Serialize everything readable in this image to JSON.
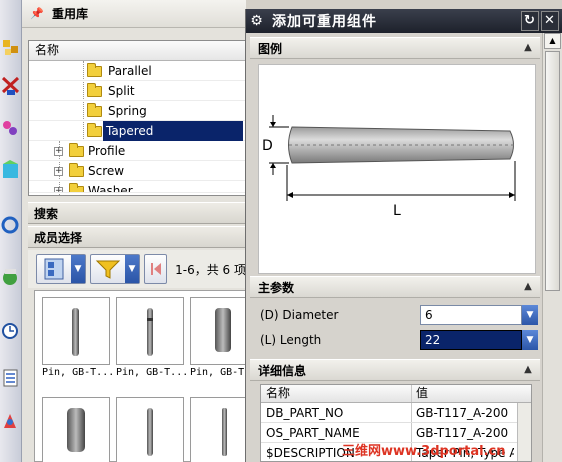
{
  "reuse_library": {
    "title": "重用库",
    "tree": {
      "column_header": "名称",
      "items": [
        {
          "label": "Parallel"
        },
        {
          "label": "Split"
        },
        {
          "label": "Spring"
        },
        {
          "label": "Tapered",
          "selected": true
        },
        {
          "label": "Profile"
        },
        {
          "label": "Screw"
        },
        {
          "label": "Washer"
        }
      ]
    },
    "search_label": "搜索",
    "member_select_label": "成员选择",
    "range_text": "1-6，共 6 项",
    "thumbnails": [
      {
        "caption": "Pin, GB-T..."
      },
      {
        "caption": "Pin, GB-T..."
      },
      {
        "caption": "Pin, GB-T..."
      }
    ]
  },
  "dialog": {
    "title": "添加可重用组件",
    "preview_group": "图例",
    "preview_labels": {
      "d": "D",
      "l": "L"
    },
    "main_params_group": "主参数",
    "params": [
      {
        "label": "(D) Diameter",
        "value": "6"
      },
      {
        "label": "(L) Length",
        "value": "22"
      }
    ],
    "details_group": "详细信息",
    "details_table": {
      "headers": [
        "名称",
        "值"
      ],
      "rows": [
        {
          "name": "DB_PART_NO",
          "value": "GB-T117_A-200"
        },
        {
          "name": "OS_PART_NAME",
          "value": "GB-T117_A-200"
        },
        {
          "name": "$DESCRIPTION",
          "value": "Taper Pin, Type A"
        }
      ]
    }
  },
  "watermark": {
    "cn": "三维网",
    "url": "www.3dportal.cn"
  }
}
